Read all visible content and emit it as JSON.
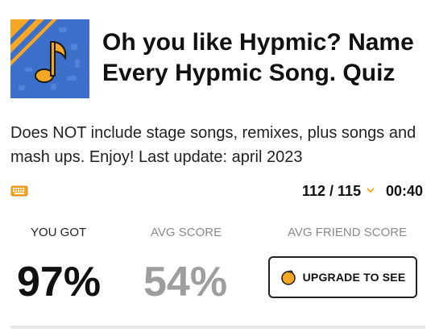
{
  "quiz": {
    "title": "Oh you like Hypmic? Name Every Hypmic Song. Quiz",
    "description": "Does NOT include stage songs, remixes, plus songs and mash ups. Enjoy! Last update: april 2023"
  },
  "status": {
    "progress": "112 / 115",
    "timer": "00:40"
  },
  "scores": {
    "you_got_label": "YOU GOT",
    "you_got_value": "97%",
    "avg_score_label": "AVG SCORE",
    "avg_score_value": "54%",
    "avg_friend_label": "AVG FRIEND SCORE",
    "upgrade_label": "UPGRADE TO SEE"
  },
  "icons": {
    "thumbnail": "music-note-icon",
    "keyboard": "keyboard-icon",
    "progress_toggle": "chevron-down-icon",
    "upgrade": "orange-icon"
  },
  "colors": {
    "accent": "#f5a623",
    "thumb_bg": "#3b6fc9",
    "muted": "#9e9e9e"
  }
}
